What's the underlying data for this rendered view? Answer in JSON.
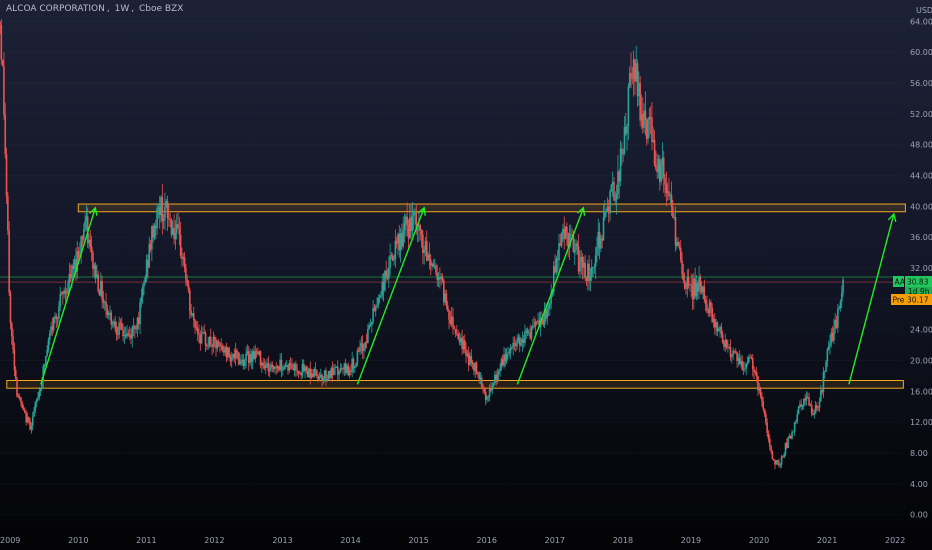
{
  "header": {
    "symbol_name": "ALCOA CORPORATION",
    "interval": "1W",
    "exchange": "Cboe BZX",
    "currency": "USD"
  },
  "badges": {
    "ticker": "AA",
    "price": "30.83",
    "countdown": "1d 9h",
    "pre_label": "Pre",
    "pre_price": "30.17",
    "green": "#22c55e",
    "orange": "#f59e0b"
  },
  "colors": {
    "up": "#26a69a",
    "down": "#ef5350",
    "zone_stroke": "#f5a623",
    "arrow": "#22ee22"
  },
  "chart_data": {
    "type": "candlestick",
    "title": "ALCOA CORPORATION, 1W, Cboe BZX",
    "ylabel": "USD",
    "ylim": [
      -2,
      66
    ],
    "xlim": [
      2008.85,
      2022.1
    ],
    "y_ticks": [
      0,
      4,
      8,
      12,
      16,
      20,
      24,
      28,
      32,
      36,
      40,
      44,
      48,
      52,
      56,
      60,
      64
    ],
    "y_tick_labels": [
      "0.00",
      "4.00",
      "8.00",
      "12.00",
      "16.00",
      "20.00",
      "24.00",
      "28.00",
      "32.00",
      "36.00",
      "40.00",
      "44.00",
      "48.00",
      "52.00",
      "56.00",
      "60.00",
      "64.00"
    ],
    "x_ticks": [
      2009,
      2010,
      2011,
      2012,
      2013,
      2014,
      2015,
      2016,
      2017,
      2018,
      2019,
      2020,
      2021,
      2022
    ],
    "x_tick_labels": [
      "2009",
      "2010",
      "2011",
      "2012",
      "2013",
      "2014",
      "2015",
      "2016",
      "2017",
      "2018",
      "2019",
      "2020",
      "2021",
      "2022"
    ],
    "price_path": [
      [
        2008.85,
        64
      ],
      [
        2008.9,
        55
      ],
      [
        2008.95,
        40
      ],
      [
        2009.0,
        25
      ],
      [
        2009.1,
        16
      ],
      [
        2009.2,
        13
      ],
      [
        2009.3,
        11.5
      ],
      [
        2009.45,
        17
      ],
      [
        2009.6,
        24
      ],
      [
        2009.75,
        28
      ],
      [
        2009.9,
        31
      ],
      [
        2010.0,
        34
      ],
      [
        2010.1,
        38
      ],
      [
        2010.2,
        33
      ],
      [
        2010.3,
        30
      ],
      [
        2010.45,
        26
      ],
      [
        2010.6,
        24
      ],
      [
        2010.75,
        23
      ],
      [
        2010.9,
        26
      ],
      [
        2011.0,
        32
      ],
      [
        2011.1,
        37
      ],
      [
        2011.2,
        40
      ],
      [
        2011.3,
        39
      ],
      [
        2011.45,
        36
      ],
      [
        2011.55,
        33
      ],
      [
        2011.65,
        26
      ],
      [
        2011.8,
        23
      ],
      [
        2012.0,
        22
      ],
      [
        2012.2,
        21
      ],
      [
        2012.4,
        20
      ],
      [
        2012.6,
        21
      ],
      [
        2012.8,
        19
      ],
      [
        2013.0,
        19.5
      ],
      [
        2013.2,
        19
      ],
      [
        2013.4,
        18.5
      ],
      [
        2013.6,
        18
      ],
      [
        2013.8,
        18.5
      ],
      [
        2014.0,
        19
      ],
      [
        2014.2,
        22
      ],
      [
        2014.4,
        28
      ],
      [
        2014.6,
        33
      ],
      [
        2014.8,
        37
      ],
      [
        2014.95,
        38
      ],
      [
        2015.1,
        34
      ],
      [
        2015.3,
        31
      ],
      [
        2015.45,
        26
      ],
      [
        2015.6,
        23
      ],
      [
        2015.75,
        20
      ],
      [
        2015.9,
        18
      ],
      [
        2016.0,
        15
      ],
      [
        2016.1,
        17
      ],
      [
        2016.3,
        21
      ],
      [
        2016.5,
        23
      ],
      [
        2016.7,
        24
      ],
      [
        2016.9,
        26
      ],
      [
        2017.0,
        32
      ],
      [
        2017.1,
        37
      ],
      [
        2017.2,
        36
      ],
      [
        2017.35,
        33
      ],
      [
        2017.5,
        31
      ],
      [
        2017.6,
        34
      ],
      [
        2017.75,
        39
      ],
      [
        2017.9,
        43
      ],
      [
        2018.0,
        47
      ],
      [
        2018.1,
        55
      ],
      [
        2018.18,
        58
      ],
      [
        2018.25,
        53
      ],
      [
        2018.4,
        50
      ],
      [
        2018.5,
        46
      ],
      [
        2018.6,
        44
      ],
      [
        2018.7,
        40
      ],
      [
        2018.8,
        35
      ],
      [
        2018.9,
        30
      ],
      [
        2019.0,
        29
      ],
      [
        2019.1,
        30
      ],
      [
        2019.25,
        27
      ],
      [
        2019.4,
        24
      ],
      [
        2019.6,
        21
      ],
      [
        2019.75,
        19
      ],
      [
        2019.9,
        20
      ],
      [
        2020.0,
        16
      ],
      [
        2020.1,
        12
      ],
      [
        2020.2,
        7
      ],
      [
        2020.3,
        6.5
      ],
      [
        2020.4,
        9
      ],
      [
        2020.5,
        11
      ],
      [
        2020.6,
        14
      ],
      [
        2020.7,
        15
      ],
      [
        2020.8,
        13
      ],
      [
        2020.9,
        15
      ],
      [
        2021.0,
        21
      ],
      [
        2021.1,
        24
      ],
      [
        2021.2,
        27
      ],
      [
        2021.25,
        30.83
      ]
    ],
    "zones": [
      {
        "x_start": 2010.0,
        "x_end": 2022.15,
        "y_low": 39.3,
        "y_high": 40.3
      },
      {
        "x_start": 2008.95,
        "x_end": 2022.12,
        "y_low": 16.4,
        "y_high": 17.4
      }
    ],
    "arrows": [
      {
        "x1": 2009.45,
        "y1": 16.9,
        "x2": 2010.25,
        "y2": 39.8
      },
      {
        "x1": 2014.1,
        "y1": 16.9,
        "x2": 2015.08,
        "y2": 39.8
      },
      {
        "x1": 2016.45,
        "y1": 16.9,
        "x2": 2017.42,
        "y2": 39.8
      },
      {
        "x1": 2021.32,
        "y1": 16.9,
        "x2": 2021.98,
        "y2": 39.0
      }
    ],
    "last_price": 30.83,
    "pre_price": 30.17
  }
}
